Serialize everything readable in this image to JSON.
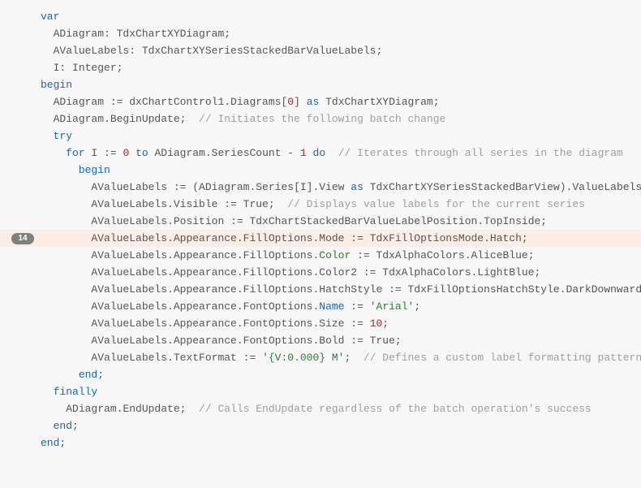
{
  "badge": "14",
  "lines": [
    {
      "indent": 0,
      "segs": [
        {
          "cls": "kw",
          "t": "var"
        }
      ]
    },
    {
      "indent": 1,
      "segs": [
        {
          "cls": "id",
          "t": "ADiagram: TdxChartXYDiagram;"
        }
      ]
    },
    {
      "indent": 1,
      "segs": [
        {
          "cls": "id",
          "t": "AValueLabels: TdxChartXYSeriesStackedBarValueLabels;"
        }
      ]
    },
    {
      "indent": 1,
      "segs": [
        {
          "cls": "id",
          "t": "I: Integer;"
        }
      ]
    },
    {
      "indent": 0,
      "segs": [
        {
          "cls": "kw",
          "t": "begin"
        }
      ]
    },
    {
      "indent": 1,
      "segs": [
        {
          "cls": "id",
          "t": "ADiagram := dxChartControl1.Diagrams["
        },
        {
          "cls": "num",
          "t": "0"
        },
        {
          "cls": "id",
          "t": "] "
        },
        {
          "cls": "kw",
          "t": "as"
        },
        {
          "cls": "id",
          "t": " TdxChartXYDiagram;"
        }
      ]
    },
    {
      "indent": 1,
      "segs": [
        {
          "cls": "id",
          "t": "ADiagram.BeginUpdate;  "
        },
        {
          "cls": "cmt",
          "t": "// Initiates the following batch change"
        }
      ]
    },
    {
      "indent": 1,
      "segs": [
        {
          "cls": "kw",
          "t": "try"
        }
      ]
    },
    {
      "indent": 2,
      "segs": [
        {
          "cls": "kw",
          "t": "for"
        },
        {
          "cls": "id",
          "t": " I := "
        },
        {
          "cls": "num",
          "t": "0"
        },
        {
          "cls": "id",
          "t": " "
        },
        {
          "cls": "kw",
          "t": "to"
        },
        {
          "cls": "id",
          "t": " ADiagram.SeriesCount - "
        },
        {
          "cls": "num",
          "t": "1"
        },
        {
          "cls": "id",
          "t": " "
        },
        {
          "cls": "kw",
          "t": "do"
        },
        {
          "cls": "id",
          "t": "  "
        },
        {
          "cls": "cmt",
          "t": "// Iterates through all series in the diagram"
        }
      ]
    },
    {
      "indent": 3,
      "segs": [
        {
          "cls": "kw",
          "t": "begin"
        }
      ]
    },
    {
      "indent": 4,
      "segs": [
        {
          "cls": "id",
          "t": "AValueLabels := (ADiagram.Series[I].View "
        },
        {
          "cls": "kw",
          "t": "as"
        },
        {
          "cls": "id",
          "t": " TdxChartXYSeriesStackedBarView).ValueLabels;"
        }
      ]
    },
    {
      "indent": 4,
      "segs": [
        {
          "cls": "id",
          "t": "AValueLabels.Visible := True;  "
        },
        {
          "cls": "cmt",
          "t": "// Displays value labels for the current series"
        }
      ]
    },
    {
      "indent": 4,
      "segs": [
        {
          "cls": "id",
          "t": "AValueLabels.Position := TdxChartStackedBarValueLabelPosition.TopInside;"
        }
      ]
    },
    {
      "indent": 4,
      "hl": true,
      "badge": true,
      "segs": [
        {
          "cls": "id",
          "t": "AValueLabels.Appearance.FillOptions.Mode := TdxFillOptionsMode.Hatch;"
        }
      ]
    },
    {
      "indent": 4,
      "segs": [
        {
          "cls": "id",
          "t": "AValueLabels.Appearance.FillOptions."
        },
        {
          "cls": "greenprop",
          "t": "Color"
        },
        {
          "cls": "id",
          "t": " := TdxAlphaColors.AliceBlue;"
        }
      ]
    },
    {
      "indent": 4,
      "segs": [
        {
          "cls": "id",
          "t": "AValueLabels.Appearance.FillOptions.Color2 := TdxAlphaColors.LightBlue;"
        }
      ]
    },
    {
      "indent": 4,
      "segs": [
        {
          "cls": "id",
          "t": "AValueLabels.Appearance.FillOptions.HatchStyle := TdxFillOptionsHatchStyle.DarkDownwardDiagonal;"
        }
      ]
    },
    {
      "indent": 4,
      "segs": [
        {
          "cls": "id",
          "t": "AValueLabels.Appearance.FontOptions."
        },
        {
          "cls": "prop",
          "t": "Name"
        },
        {
          "cls": "id",
          "t": " := "
        },
        {
          "cls": "str",
          "t": "'Arial'"
        },
        {
          "cls": "id",
          "t": ";"
        }
      ]
    },
    {
      "indent": 4,
      "segs": [
        {
          "cls": "id",
          "t": "AValueLabels.Appearance.FontOptions.Size := "
        },
        {
          "cls": "num",
          "t": "10"
        },
        {
          "cls": "id",
          "t": ";"
        }
      ]
    },
    {
      "indent": 4,
      "segs": [
        {
          "cls": "id",
          "t": "AValueLabels.Appearance.FontOptions.Bold := True;"
        }
      ]
    },
    {
      "indent": 4,
      "segs": [
        {
          "cls": "id",
          "t": "AValueLabels.TextFormat := "
        },
        {
          "cls": "str",
          "t": "'{V:0.000} M'"
        },
        {
          "cls": "id",
          "t": ";  "
        },
        {
          "cls": "cmt",
          "t": "// Defines a custom label formatting pattern"
        }
      ]
    },
    {
      "indent": 3,
      "segs": [
        {
          "cls": "kw",
          "t": "end"
        },
        {
          "cls": "id",
          "t": ";"
        }
      ]
    },
    {
      "indent": 1,
      "segs": [
        {
          "cls": "kw",
          "t": "finally"
        }
      ]
    },
    {
      "indent": 2,
      "segs": [
        {
          "cls": "id",
          "t": "ADiagram.EndUpdate;  "
        },
        {
          "cls": "cmt",
          "t": "// Calls EndUpdate regardless of the batch operation's success"
        }
      ]
    },
    {
      "indent": 1,
      "segs": [
        {
          "cls": "kw",
          "t": "end"
        },
        {
          "cls": "id",
          "t": ";"
        }
      ]
    },
    {
      "indent": 0,
      "segs": [
        {
          "cls": "kw",
          "t": "end"
        },
        {
          "cls": "id",
          "t": ";"
        }
      ]
    }
  ]
}
